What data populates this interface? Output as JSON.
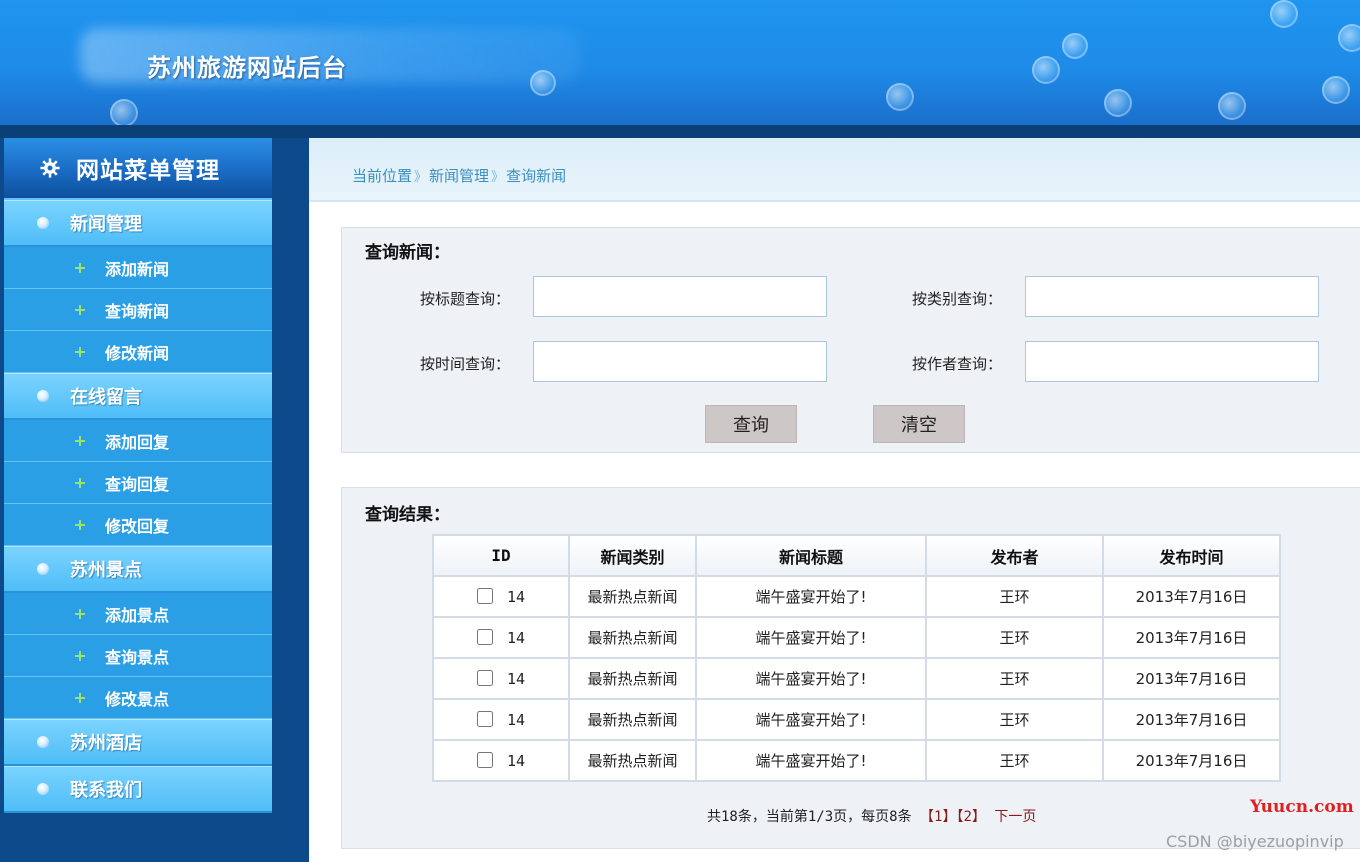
{
  "header": {
    "site_title": "苏州旅游网站后台"
  },
  "sidebar": {
    "title": "网站菜单管理",
    "categories": [
      {
        "label": "新闻管理",
        "items": [
          "添加新闻",
          "查询新闻",
          "修改新闻"
        ]
      },
      {
        "label": "在线留言",
        "items": [
          "添加回复",
          "查询回复",
          "修改回复"
        ]
      },
      {
        "label": "苏州景点",
        "items": [
          "添加景点",
          "查询景点",
          "修改景点"
        ]
      },
      {
        "label": "苏州酒店",
        "items": []
      },
      {
        "label": "联系我们",
        "items": []
      }
    ]
  },
  "breadcrumb": {
    "items": [
      "当前位置",
      "新闻管理",
      "查询新闻"
    ],
    "separator": "》"
  },
  "query": {
    "title": "查询新闻：",
    "by_title_label": "按标题查询：",
    "by_category_label": "按类别查询：",
    "by_time_label": "按时间查询：",
    "by_author_label": "按作者查询：",
    "by_title_value": "",
    "by_category_value": "",
    "by_time_value": "",
    "by_author_value": "",
    "search_button": "查询",
    "clear_button": "清空"
  },
  "results": {
    "title": "查询结果：",
    "columns": [
      "ID",
      "新闻类别",
      "新闻标题",
      "发布者",
      "发布时间"
    ],
    "rows": [
      {
        "id": "14",
        "category": "最新热点新闻",
        "title": "端午盛宴开始了!",
        "author": "王环",
        "date": "2013年7月16日"
      },
      {
        "id": "14",
        "category": "最新热点新闻",
        "title": "端午盛宴开始了!",
        "author": "王环",
        "date": "2013年7月16日"
      },
      {
        "id": "14",
        "category": "最新热点新闻",
        "title": "端午盛宴开始了!",
        "author": "王环",
        "date": "2013年7月16日"
      },
      {
        "id": "14",
        "category": "最新热点新闻",
        "title": "端午盛宴开始了!",
        "author": "王环",
        "date": "2013年7月16日"
      },
      {
        "id": "14",
        "category": "最新热点新闻",
        "title": "端午盛宴开始了!",
        "author": "王环",
        "date": "2013年7月16日"
      }
    ]
  },
  "pager": {
    "summary": "共18条，当前第1/3页，每页8条",
    "pages": [
      "【1】",
      "【2】"
    ],
    "next_label": "下一页"
  },
  "watermarks": {
    "yuucn": "Yuucn.com",
    "csdn": "CSDN @biyezuopinvip"
  },
  "colors": {
    "header_blue": "#1f95ef",
    "sidebar_dark": "#0c4a8c",
    "category_blue": "#4fbdf7",
    "subitem_blue": "#2b9fe6",
    "breadcrumb_text": "#3c8fbd",
    "pager_link": "#8a1a1a",
    "button_gray": "#cdc7c7"
  },
  "icons": {
    "menu_header": "gear-icon",
    "category": "bullet-dot-icon",
    "subitem": "plus-icon"
  }
}
